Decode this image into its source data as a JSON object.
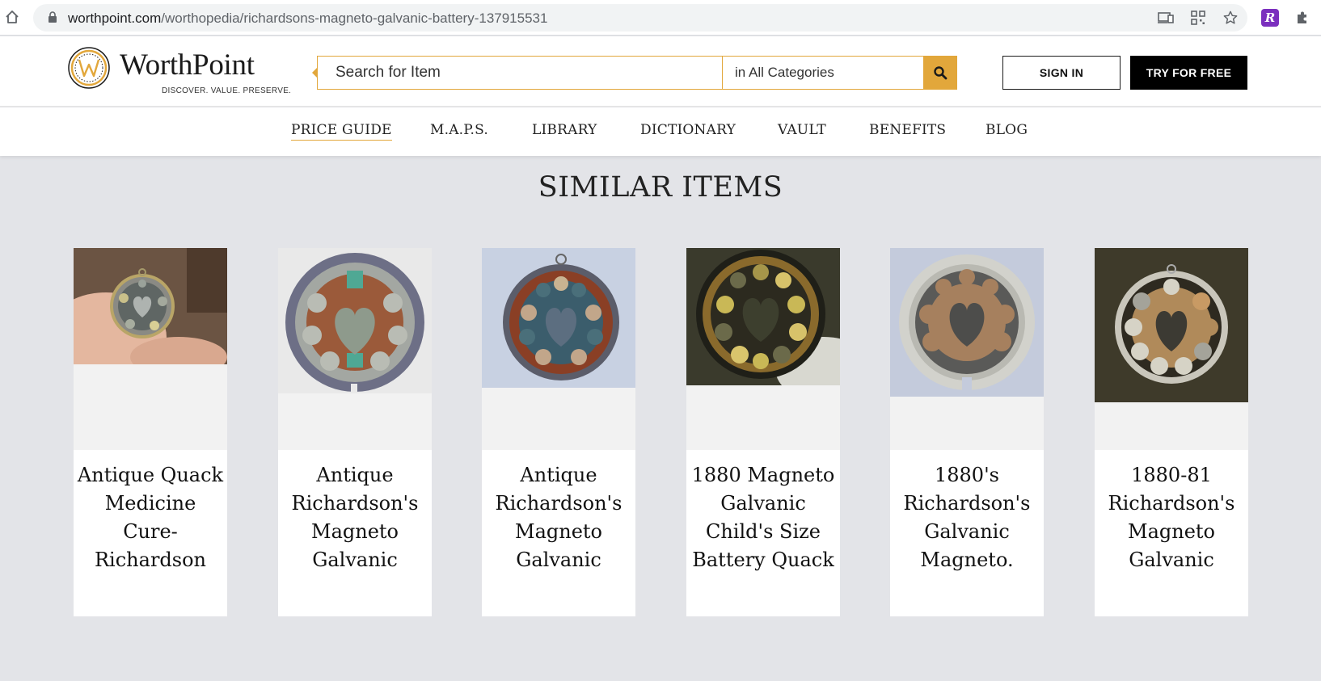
{
  "browser": {
    "url_host": "worthpoint.com",
    "url_path": "/worthopedia/richardsons-magneto-galvanic-battery-137915531",
    "icons": [
      "home-icon",
      "lock-icon",
      "cast-icon",
      "qr-code-icon",
      "star-icon",
      "extension-r-icon",
      "puzzle-icon"
    ],
    "extension_letter": "R"
  },
  "header": {
    "logo_name": "WorthPoint",
    "logo_tagline": "DISCOVER. VALUE. PRESERVE.",
    "search_placeholder": "Search for Item",
    "category_value": "in All Categories",
    "signin_label": "SIGN IN",
    "try_label": "TRY FOR FREE"
  },
  "nav": {
    "items": [
      {
        "label": "PRICE GUIDE",
        "active": true
      },
      {
        "label": "M.A.P.S.",
        "active": false
      },
      {
        "label": "LIBRARY",
        "active": false
      },
      {
        "label": "DICTIONARY",
        "active": false
      },
      {
        "label": "VAULT",
        "active": false
      },
      {
        "label": "BENEFITS",
        "active": false
      },
      {
        "label": "BLOG",
        "active": false
      }
    ]
  },
  "section": {
    "title": "SIMILAR ITEMS"
  },
  "items": [
    {
      "title": "Antique Quack Medicine Cure-Richardson"
    },
    {
      "title": "Antique Richardson's Magneto Galvanic"
    },
    {
      "title": "Antique Richardson's Magneto Galvanic"
    },
    {
      "title": "1880 Magneto Galvanic Child's Size Battery Quack"
    },
    {
      "title": "1880's Richardson's Galvanic Magneto."
    },
    {
      "title": "1880-81 Richardson's Magneto Galvanic"
    }
  ],
  "colors": {
    "accent": "#e2a73b",
    "page_bg": "#e3e4e8",
    "text": "#222222"
  }
}
